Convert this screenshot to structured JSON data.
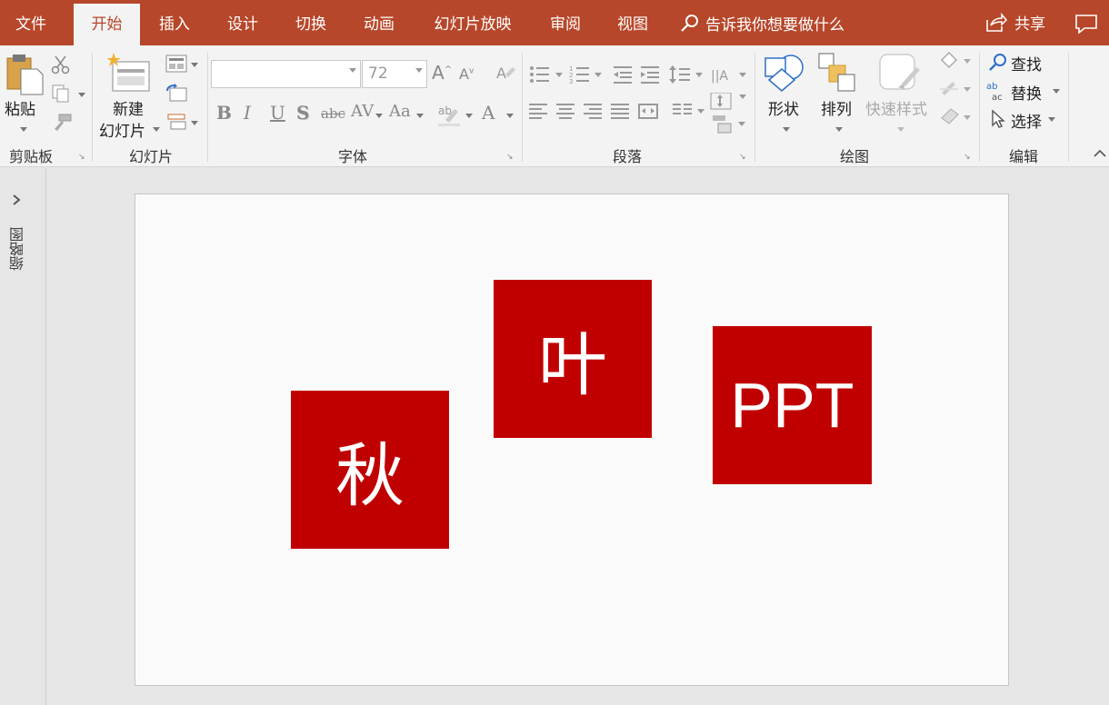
{
  "tabs": {
    "file": "文件",
    "home": "开始",
    "insert": "插入",
    "design": "设计",
    "transitions": "切换",
    "animations": "动画",
    "slideshow": "幻灯片放映",
    "review": "审阅",
    "view": "视图"
  },
  "tell_me": "告诉我你想要做什么",
  "share": "共享",
  "ribbon": {
    "clipboard": {
      "paste": "粘贴",
      "group": "剪贴板"
    },
    "slides": {
      "new_line1": "新建",
      "new_line2": "幻灯片",
      "group": "幻灯片"
    },
    "font": {
      "font_name": "",
      "font_size": "72",
      "group": "字体"
    },
    "paragraph": {
      "group": "段落"
    },
    "drawing": {
      "shapes": "形状",
      "arrange": "排列",
      "quick_styles": "快速样式",
      "group": "绘图"
    },
    "editing": {
      "find": "查找",
      "replace": "替换",
      "select": "选择",
      "group": "编辑"
    }
  },
  "thumbnails_label": "缩略图",
  "slide": {
    "box1": "秋",
    "box2": "叶",
    "box3": "PPT"
  },
  "colors": {
    "accent": "#b7472a",
    "box": "#c00000"
  }
}
